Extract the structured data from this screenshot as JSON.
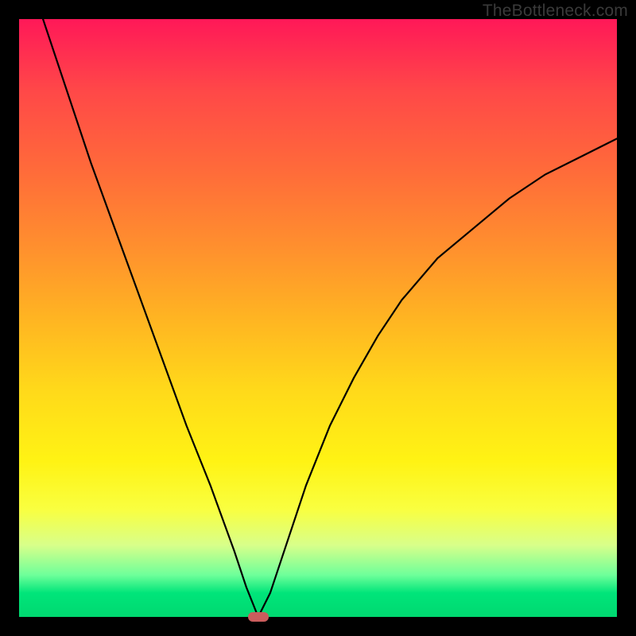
{
  "watermark": "TheBottleneck.com",
  "chart_data": {
    "type": "line",
    "title": "",
    "xlabel": "",
    "ylabel": "",
    "xlim": [
      0,
      100
    ],
    "ylim": [
      0,
      100
    ],
    "grid": false,
    "legend": false,
    "background_gradient": {
      "top": "#ff1858",
      "mid": "#ffe014",
      "bottom": "#00d870"
    },
    "series": [
      {
        "name": "bottleneck-curve",
        "color": "#000000",
        "x": [
          4,
          8,
          12,
          16,
          20,
          24,
          28,
          32,
          36,
          38,
          40,
          42,
          44,
          48,
          52,
          56,
          60,
          64,
          70,
          76,
          82,
          88,
          94,
          100
        ],
        "y": [
          100,
          88,
          76,
          65,
          54,
          43,
          32,
          22,
          11,
          5,
          0,
          4,
          10,
          22,
          32,
          40,
          47,
          53,
          60,
          65,
          70,
          74,
          77,
          80
        ]
      }
    ],
    "marker": {
      "name": "optimum-marker",
      "x": 40,
      "y": 0,
      "color": "#cb5d5d",
      "shape": "pill"
    }
  }
}
